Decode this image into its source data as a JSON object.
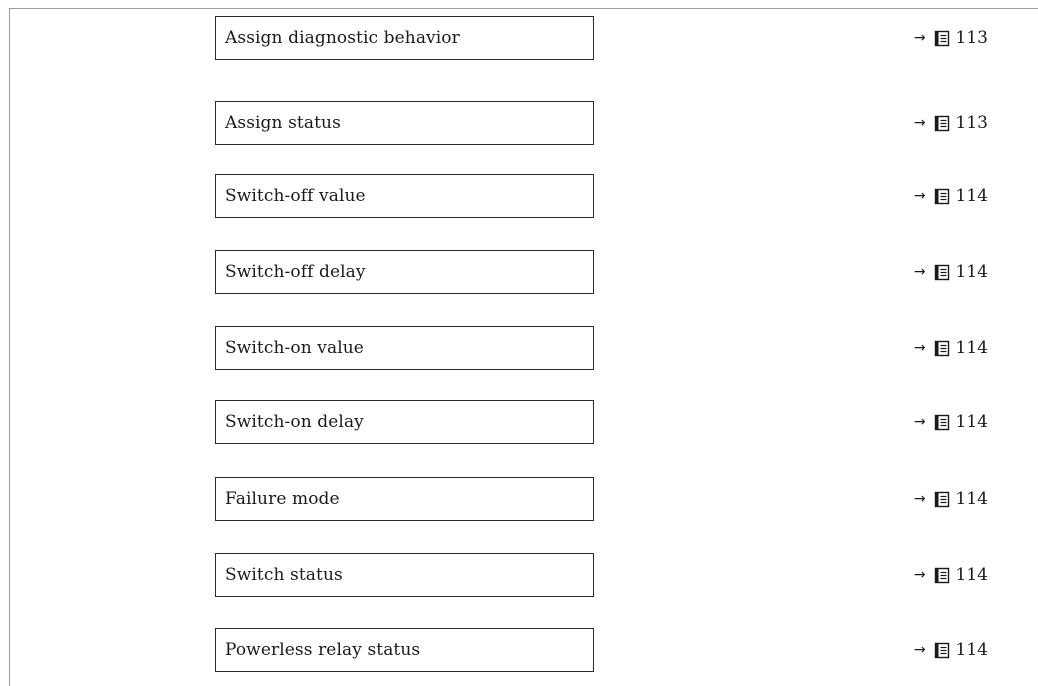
{
  "parameters": [
    {
      "label": "Assign diagnostic behavior",
      "arrow": "→",
      "page_icon": "book-icon",
      "page": "113"
    },
    {
      "label": "Assign status",
      "arrow": "→",
      "page_icon": "book-icon",
      "page": "113"
    },
    {
      "label": "Switch-off value",
      "arrow": "→",
      "page_icon": "book-icon",
      "page": "114"
    },
    {
      "label": "Switch-off delay",
      "arrow": "→",
      "page_icon": "book-icon",
      "page": "114"
    },
    {
      "label": "Switch-on value",
      "arrow": "→",
      "page_icon": "book-icon",
      "page": "114"
    },
    {
      "label": "Switch-on delay",
      "arrow": "→",
      "page_icon": "book-icon",
      "page": "114"
    },
    {
      "label": "Failure mode",
      "arrow": "→",
      "page_icon": "book-icon",
      "page": "114"
    },
    {
      "label": "Switch status",
      "arrow": "→",
      "page_icon": "book-icon",
      "page": "114"
    },
    {
      "label": "Powerless relay status",
      "arrow": "→",
      "page_icon": "book-icon",
      "page": "114"
    }
  ]
}
